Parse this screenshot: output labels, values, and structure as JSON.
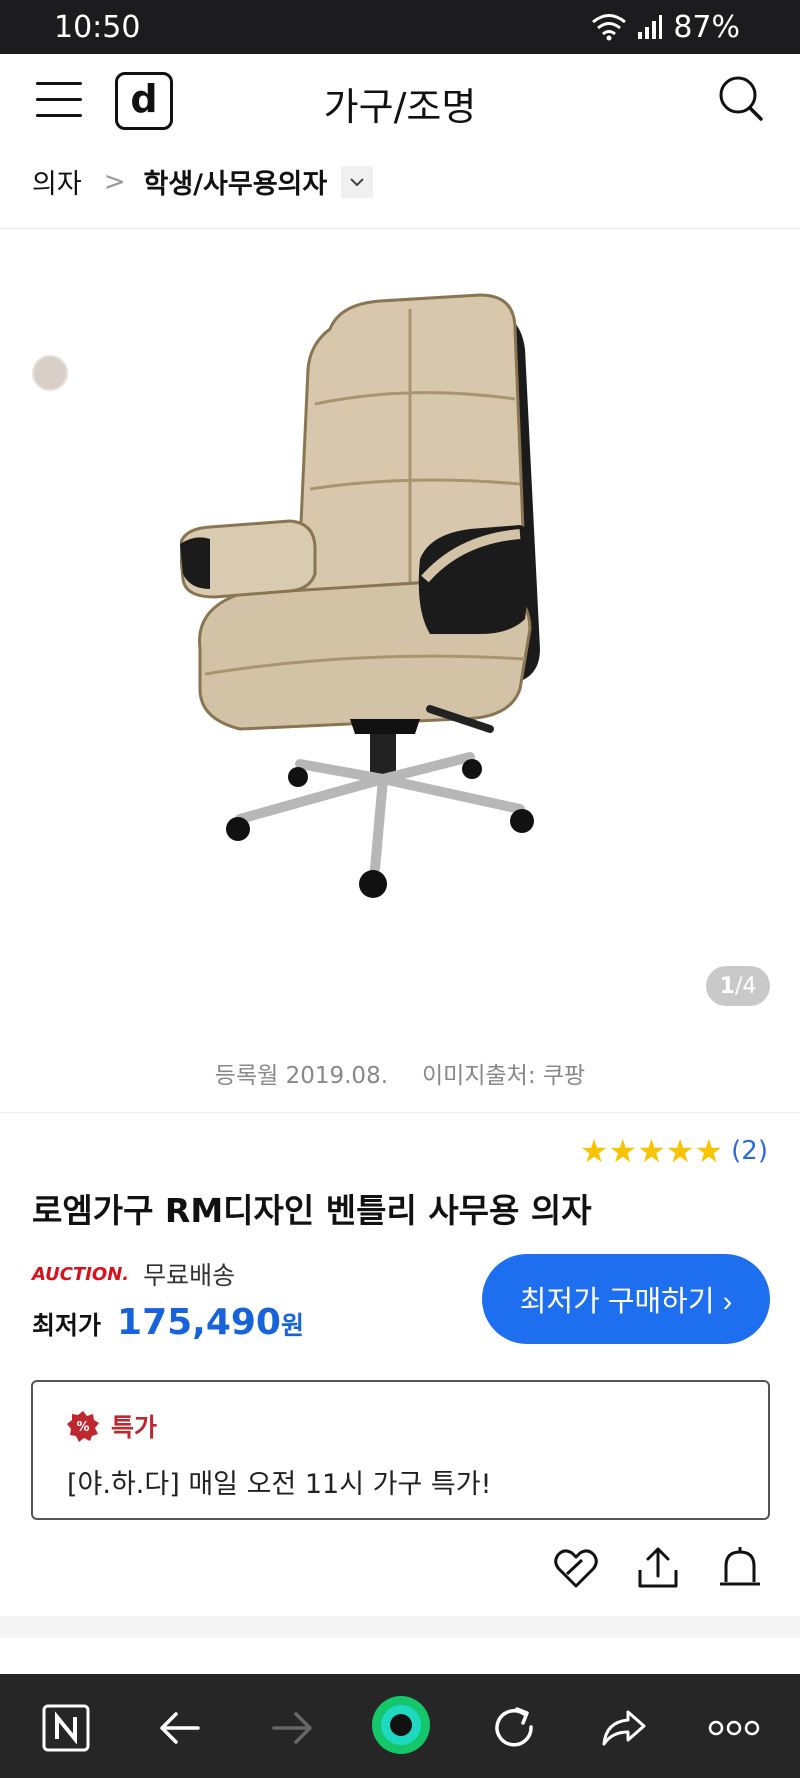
{
  "status_bar": {
    "time": "10:50",
    "battery": "87%"
  },
  "header": {
    "logo_letter": "d",
    "title": "가구/조명"
  },
  "breadcrumb": {
    "parent": "의자",
    "separator": ">",
    "current": "학생/사무용의자"
  },
  "gallery": {
    "current": "1",
    "total": "/4"
  },
  "meta": {
    "registered": "등록월 2019.08.",
    "image_source": "이미지출처: 쿠팡"
  },
  "product": {
    "stars": "★★★★★",
    "review_count": "(2)",
    "title": "로엠가구 RM디자인 벤틀리 사무용 의자",
    "seller_logo": "AUCTION.",
    "shipping": "무료배송",
    "price_label": "최저가",
    "price": "175,490",
    "price_unit": "원",
    "buy_button": "최저가 구매하기 ›"
  },
  "promo": {
    "label": "특가",
    "text": "[야.하.다] 매일 오전 11시 가구 특가!"
  },
  "colors": {
    "accent_blue": "#1e6ef0",
    "price_blue": "#1763d9",
    "promo_red": "#c0282f",
    "star_yellow": "#f6c400"
  }
}
